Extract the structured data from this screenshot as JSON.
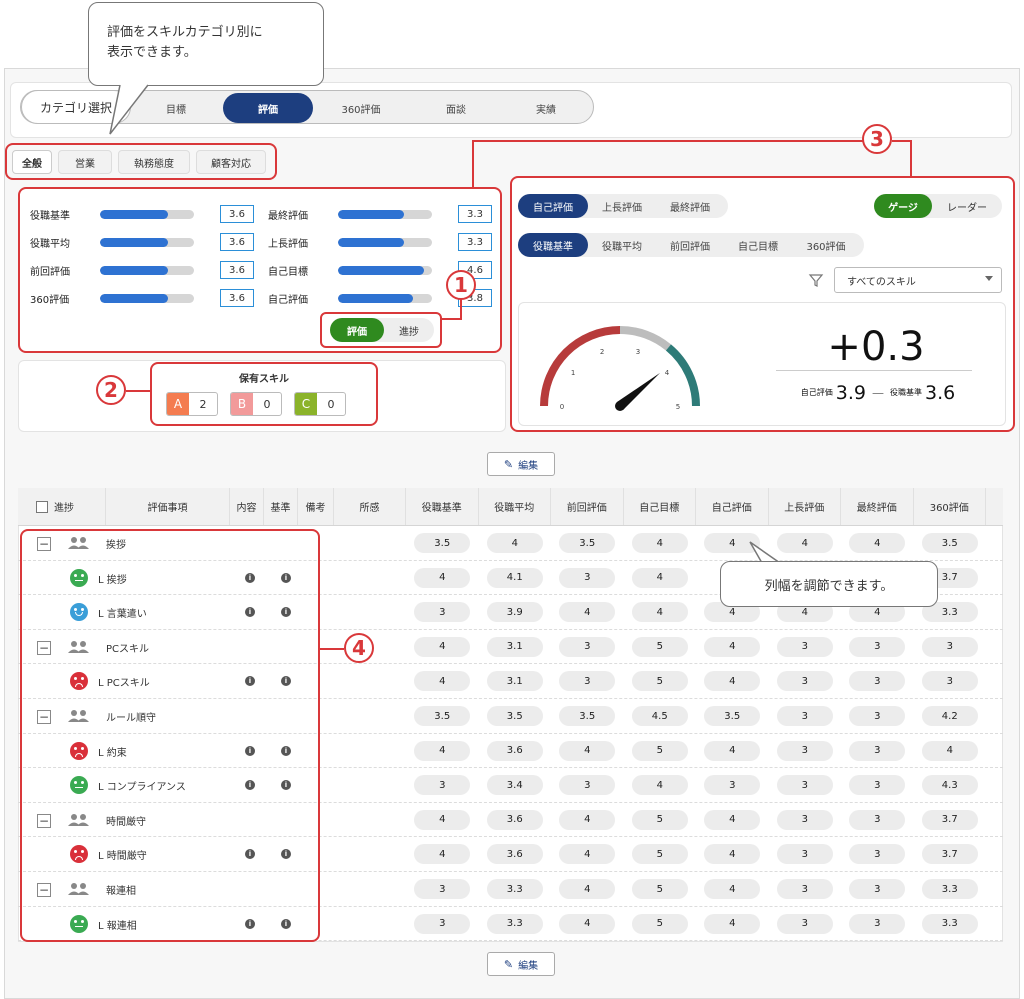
{
  "callouts": {
    "category_tip": "評価をスキルカテゴリ別に\n表示できます。",
    "column_tip": "列幅を調節できます。"
  },
  "category": {
    "label": "カテゴリ選択",
    "options": [
      "目標",
      "評価",
      "360評価",
      "面談",
      "実績"
    ],
    "selected": "評価"
  },
  "skill_tabs": [
    "全般",
    "営業",
    "執務態度",
    "顧客対応"
  ],
  "metrics": {
    "left": [
      {
        "label": "役職基準",
        "value": "3.6",
        "fill": 0.72
      },
      {
        "label": "役職平均",
        "value": "3.6",
        "fill": 0.72
      },
      {
        "label": "前回評価",
        "value": "3.6",
        "fill": 0.72
      },
      {
        "label": "360評価",
        "value": "3.6",
        "fill": 0.72
      }
    ],
    "right": [
      {
        "label": "最終評価",
        "value": "3.3",
        "fill": 0.7
      },
      {
        "label": "上長評価",
        "value": "3.3",
        "fill": 0.7
      },
      {
        "label": "自己目標",
        "value": "4.6",
        "fill": 0.92
      },
      {
        "label": "自己評価",
        "value": "3.8",
        "fill": 0.8
      }
    ],
    "toggle": {
      "on": "評価",
      "off": "進捗"
    }
  },
  "owned_skills": {
    "title": "保有スキル",
    "items": [
      {
        "letter": "A",
        "count": "2",
        "color": "#f47c50"
      },
      {
        "letter": "B",
        "count": "0",
        "color": "#f29a9a"
      },
      {
        "letter": "C",
        "count": "0",
        "color": "#8bb32a"
      }
    ]
  },
  "badges": [
    "1",
    "2",
    "3",
    "4"
  ],
  "gauge_panel": {
    "eval_tabs": [
      "自己評価",
      "上長評価",
      "最終評価"
    ],
    "eval_selected": "自己評価",
    "view_toggle": {
      "on": "ゲージ",
      "off": "レーダー"
    },
    "compare_tabs": [
      "役職基準",
      "役職平均",
      "前回評価",
      "自己目標",
      "360評価"
    ],
    "compare_selected": "役職基準",
    "filter_value": "すべてのスキル",
    "gauge_ticks": [
      "0",
      "1",
      "2",
      "3",
      "4",
      "5"
    ],
    "gauge_value": 3.9,
    "diff": "+0.3",
    "left_label": "自己評価",
    "left_value": "3.9",
    "dash": "—",
    "right_label": "役職基準",
    "right_value": "3.6"
  },
  "edit_label": "編集",
  "table": {
    "fixed_headers": [
      "進捗",
      "評価事項",
      "内容",
      "基準",
      "備考",
      "所感"
    ],
    "score_headers": [
      "役職基準",
      "役職平均",
      "前回評価",
      "自己目標",
      "自己評価",
      "上長評価",
      "最終評価",
      "360評価"
    ],
    "rows": [
      {
        "type": "group",
        "name": "挨拶",
        "scores": [
          "3.5",
          "4",
          "3.5",
          "4",
          "4",
          "4",
          "4",
          "3.5"
        ]
      },
      {
        "type": "item",
        "name": "L 挨拶",
        "mood": "neutral",
        "scores": [
          "4",
          "4.1",
          "3",
          "4",
          "",
          "",
          "",
          "3.7"
        ]
      },
      {
        "type": "item",
        "name": "L 言葉遣い",
        "mood": "happy",
        "scores": [
          "3",
          "3.9",
          "4",
          "4",
          "4",
          "4",
          "4",
          "3.3"
        ]
      },
      {
        "type": "group",
        "name": "PCスキル",
        "scores": [
          "4",
          "3.1",
          "3",
          "5",
          "4",
          "3",
          "3",
          "3"
        ]
      },
      {
        "type": "item",
        "name": "L PCスキル",
        "mood": "sad",
        "scores": [
          "4",
          "3.1",
          "3",
          "5",
          "4",
          "3",
          "3",
          "3"
        ]
      },
      {
        "type": "group",
        "name": "ルール順守",
        "scores": [
          "3.5",
          "3.5",
          "3.5",
          "4.5",
          "3.5",
          "3",
          "3",
          "4.2"
        ]
      },
      {
        "type": "item",
        "name": "L 約束",
        "mood": "sad",
        "scores": [
          "4",
          "3.6",
          "4",
          "5",
          "4",
          "3",
          "3",
          "4"
        ]
      },
      {
        "type": "item",
        "name": "L コンプライアンス",
        "mood": "neutral",
        "scores": [
          "3",
          "3.4",
          "3",
          "4",
          "3",
          "3",
          "3",
          "4.3"
        ]
      },
      {
        "type": "group",
        "name": "時間厳守",
        "scores": [
          "4",
          "3.6",
          "4",
          "5",
          "4",
          "3",
          "3",
          "3.7"
        ]
      },
      {
        "type": "item",
        "name": "L 時間厳守",
        "mood": "sad",
        "scores": [
          "4",
          "3.6",
          "4",
          "5",
          "4",
          "3",
          "3",
          "3.7"
        ]
      },
      {
        "type": "group",
        "name": "報連相",
        "scores": [
          "3",
          "3.3",
          "4",
          "5",
          "4",
          "3",
          "3",
          "3.3"
        ]
      },
      {
        "type": "item",
        "name": "L 報連相",
        "mood": "neutral",
        "scores": [
          "3",
          "3.3",
          "4",
          "5",
          "4",
          "3",
          "3",
          "3.3"
        ]
      }
    ]
  },
  "colors": {
    "accent": "#1d3e7f",
    "green": "#2f8a1f",
    "annotation": "#d9383a",
    "bar": "#2e72d2"
  }
}
